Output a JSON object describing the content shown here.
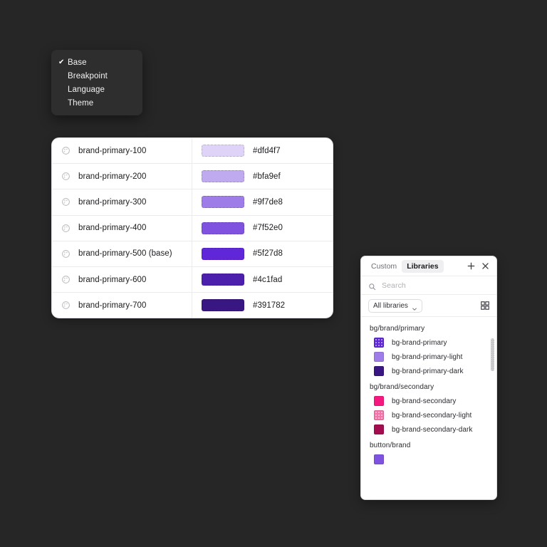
{
  "background_color": "#262626",
  "context_menu": {
    "items": [
      {
        "label": "Base",
        "checked": true,
        "check_glyph": "✔"
      },
      {
        "label": "Breakpoint",
        "checked": false,
        "check_glyph": ""
      },
      {
        "label": "Language",
        "checked": false,
        "check_glyph": ""
      },
      {
        "label": "Theme",
        "checked": false,
        "check_glyph": ""
      }
    ]
  },
  "token_table": {
    "rows": [
      {
        "name": "brand-primary-100",
        "hex": "#dfd4f7",
        "swatch": "#dfd4f7"
      },
      {
        "name": "brand-primary-200",
        "hex": "#bfa9ef",
        "swatch": "#bfa9ef"
      },
      {
        "name": "brand-primary-300",
        "hex": "#9f7de8",
        "swatch": "#9f7de8"
      },
      {
        "name": "brand-primary-400",
        "hex": "#7f52e0",
        "swatch": "#7f52e0"
      },
      {
        "name": "brand-primary-500 (base)",
        "hex": "#5f27d8",
        "swatch": "#5f27d8"
      },
      {
        "name": "brand-primary-600",
        "hex": "#4c1fad",
        "swatch": "#4c1fad"
      },
      {
        "name": "brand-primary-700",
        "hex": "#391782",
        "swatch": "#391782"
      }
    ]
  },
  "libraries_panel": {
    "tabs": [
      {
        "label": "Custom",
        "active": false
      },
      {
        "label": "Libraries",
        "active": true
      }
    ],
    "add_icon": "plus-icon",
    "close_icon": "close-icon",
    "search": {
      "placeholder": "Search",
      "value": "",
      "icon": "search-icon"
    },
    "filter": {
      "label": "All libraries",
      "icon": "chevron-down-icon"
    },
    "view_toggle": "grid-view-icon",
    "groups": [
      {
        "name": "bg/brand/primary",
        "items": [
          {
            "label": "bg-brand-primary",
            "color": "#5f27d8",
            "textured": true
          },
          {
            "label": "bg-brand-primary-light",
            "color": "#9f7de8",
            "textured": false
          },
          {
            "label": "bg-brand-primary-dark",
            "color": "#391782",
            "textured": false
          }
        ]
      },
      {
        "name": "bg/brand/secondary",
        "items": [
          {
            "label": "bg-brand-secondary",
            "color": "#f5197f",
            "textured": false
          },
          {
            "label": "bg-brand-secondary-light",
            "color": "#f573a8",
            "textured": true
          },
          {
            "label": "bg-brand-secondary-dark",
            "color": "#a30d4f",
            "textured": false
          }
        ]
      },
      {
        "name": "button/brand",
        "items": [
          {
            "label": "",
            "color": "#7f52e0",
            "textured": false
          }
        ]
      }
    ]
  }
}
